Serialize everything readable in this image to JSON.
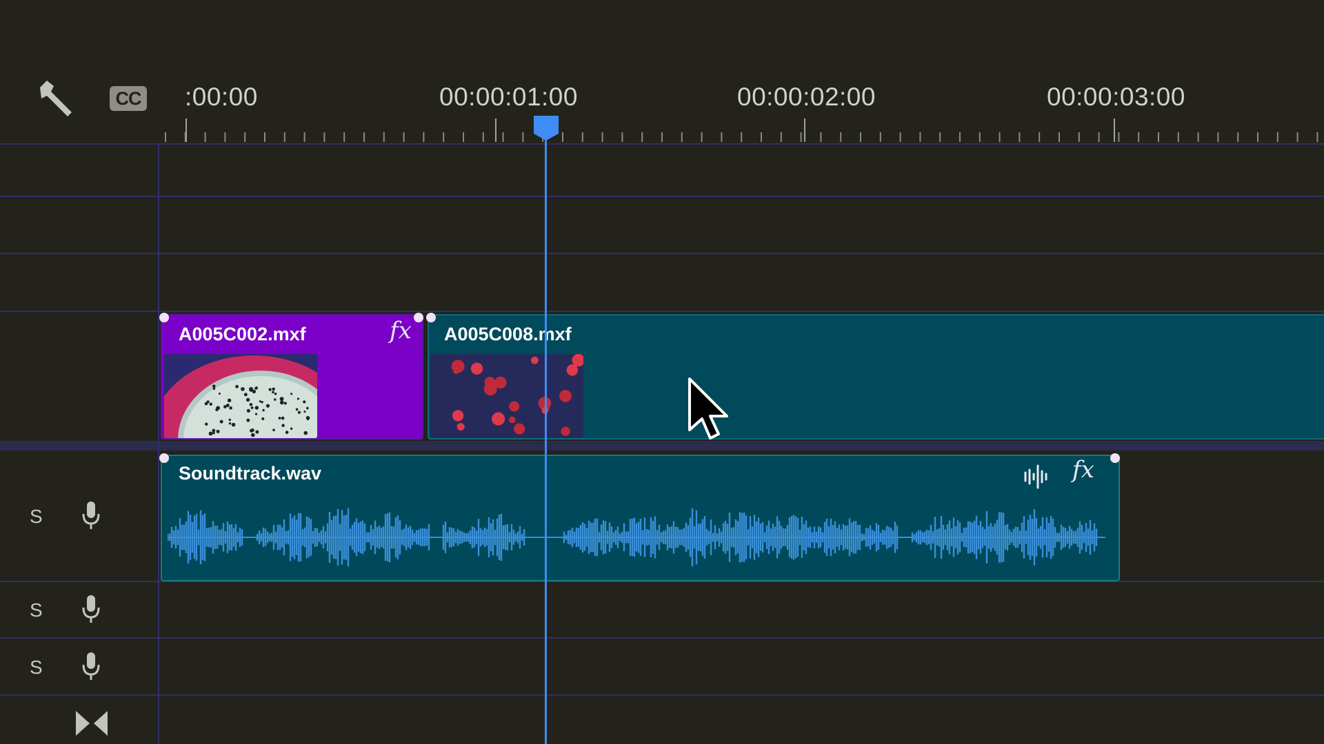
{
  "header": {
    "tool_icon": "wrench-icon",
    "cc_label": "CC",
    "timecodes": [
      ":00:00",
      "00:00:01:00",
      "00:00:02:00",
      "00:00:03:00"
    ]
  },
  "tracks": {
    "video": [
      {
        "name": "A005C002.mxf",
        "has_fx": true,
        "fx_label": "fx",
        "color": "#7b00c8"
      },
      {
        "name": "A005C008.mxf",
        "has_fx": false,
        "color": "#004a5b"
      }
    ],
    "audio": [
      {
        "name": "Soundtrack.wav",
        "fx_label": "fx",
        "waveform_icon": "waveform-icon",
        "solo_label": "S",
        "mic_icon": "microphone-icon"
      },
      {
        "solo_label": "S",
        "mic_icon": "microphone-icon"
      },
      {
        "solo_label": "S",
        "mic_icon": "microphone-icon"
      }
    ]
  },
  "footer": {
    "sync_icon": "sync-lock-icon"
  },
  "playhead": {
    "timecode_fraction": 1.12
  },
  "colors": {
    "background": "#23231b",
    "playhead": "#3f8df4",
    "video_clip_fx": "#7b00c8",
    "video_clip": "#004a5b",
    "audio_clip": "#00495a",
    "waveform": "#3a8fd8",
    "track_divider": "#2f2f6a"
  }
}
